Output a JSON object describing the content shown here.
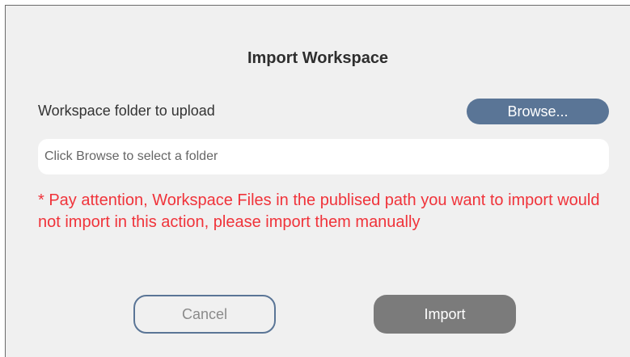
{
  "dialog": {
    "title": "Import Workspace",
    "folder_label": "Workspace folder to upload",
    "browse_label": "Browse...",
    "folder_input": {
      "value": "",
      "placeholder": "Click Browse to select a folder"
    },
    "warning": "* Pay attention, Workspace Files in the publised path you want to import would not import in this action, please import them manually",
    "cancel_label": "Cancel",
    "import_label": "Import"
  },
  "colors": {
    "background": "#f0f0f0",
    "accent": "#5a7596",
    "warning_text": "#f0333a",
    "import_button": "#7b7b7b"
  }
}
